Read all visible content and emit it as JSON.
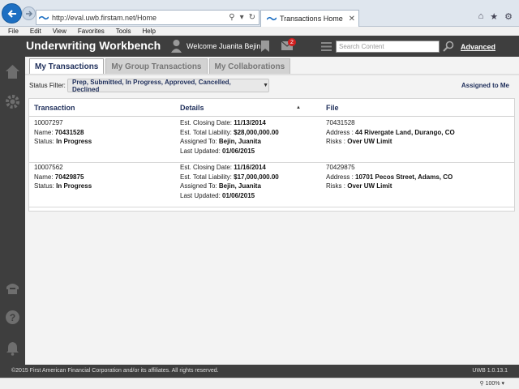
{
  "browser": {
    "url": "http://eval.uwb.firstam.net/Home",
    "tab_title": "Transactions Home",
    "menu": [
      "File",
      "Edit",
      "View",
      "Favorites",
      "Tools",
      "Help"
    ]
  },
  "header": {
    "app_title": "Underwriting Workbench",
    "welcome": "Welcome Juanita Bejin",
    "mail_count": "2",
    "search_placeholder": "Search Content",
    "advanced": "Advanced"
  },
  "tabs": [
    {
      "label": "My Transactions",
      "active": true
    },
    {
      "label": "My Group Transactions",
      "active": false
    },
    {
      "label": "My Collaborations",
      "active": false
    }
  ],
  "filter": {
    "label": "Status Filter:",
    "value": "Prep, Submitted, In Progress, Approved, Cancelled, Declined",
    "assigned_link": "Assigned to Me"
  },
  "table": {
    "headers": {
      "transaction": "Transaction",
      "details": "Details",
      "file": "File"
    },
    "rows": [
      {
        "id": "10007297",
        "name_label": "Name:",
        "name": "70431528",
        "status_label": "Status:",
        "status": "In Progress",
        "closing_label": "Est. Closing Date:",
        "closing": "11/13/2014",
        "liability_label": "Est. Total Liability:",
        "liability": "$28,000,000.00",
        "assigned_label": "Assigned To:",
        "assigned": "Bejin, Juanita",
        "updated_label": "Last Updated:",
        "updated": "01/06/2015",
        "file_no": "70431528",
        "address_label": "Address :",
        "address": "44 Rivergate Land, Durango, CO",
        "risks_label": "Risks :",
        "risks": "Over UW Limit"
      },
      {
        "id": "10007562",
        "name_label": "Name:",
        "name": "70429875",
        "status_label": "Status:",
        "status": "In Progress",
        "closing_label": "Est. Closing Date:",
        "closing": "11/16/2014",
        "liability_label": "Est. Total Liability:",
        "liability": "$17,000,000.00",
        "assigned_label": "Assigned To:",
        "assigned": "Bejin, Juanita",
        "updated_label": "Last Updated:",
        "updated": "01/06/2015",
        "file_no": "70429875",
        "address_label": "Address :",
        "address": "10701 Pecos Street, Adams, CO",
        "risks_label": "Risks :",
        "risks": "Over UW Limit"
      }
    ]
  },
  "footer": {
    "copyright": "©2015 First American Financial Corporation and/or its affiliates. All rights reserved.",
    "version": "UWB 1.0.13.1"
  },
  "taskbar": {
    "zoom": "100%"
  }
}
